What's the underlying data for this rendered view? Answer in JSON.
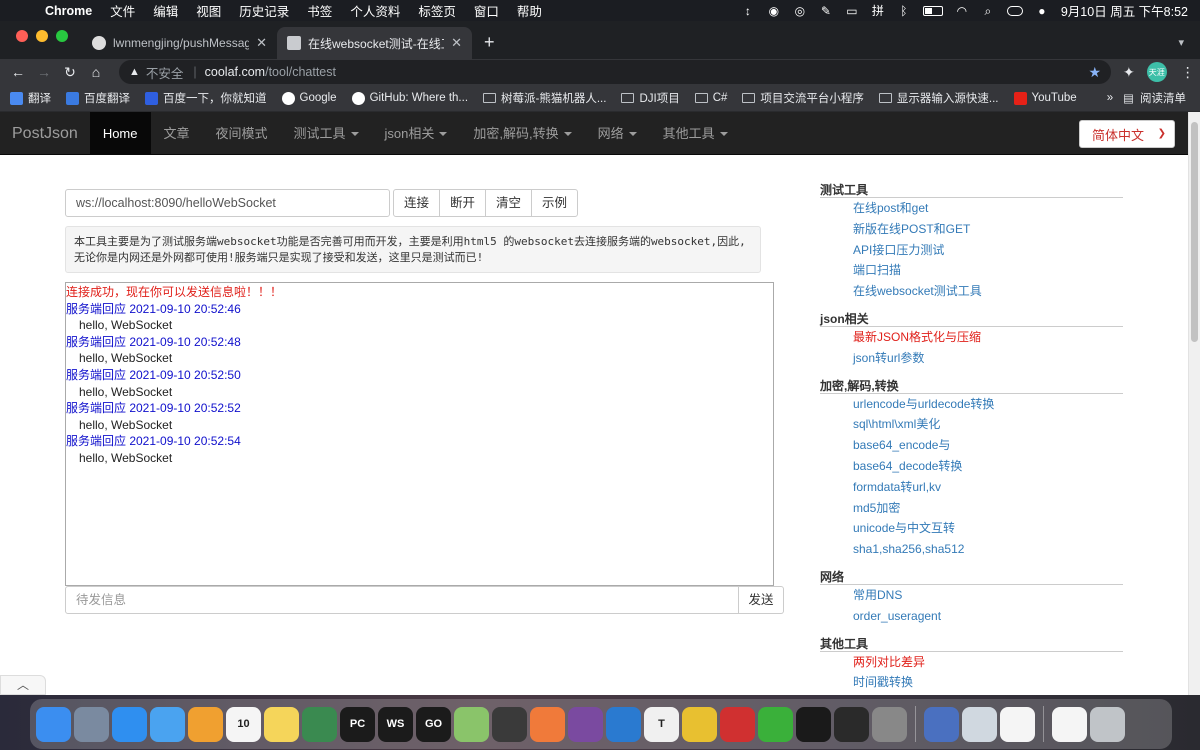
{
  "menubar": {
    "app": "Chrome",
    "items": [
      "文件",
      "编辑",
      "视图",
      "历史记录",
      "书签",
      "个人资料",
      "标签页",
      "窗口",
      "帮助"
    ],
    "clock": "9月10日 周五 下午8:52"
  },
  "tabs": [
    {
      "title": "lwnmengjing/pushMessage: Gi",
      "active": false
    },
    {
      "title": "在线websocket测试-在线工具-p",
      "active": true
    }
  ],
  "addressbar": {
    "security": "不安全",
    "host": "coolaf.com",
    "path": "/tool/chattest",
    "profile": "天涯"
  },
  "bookmarks": [
    "翻译",
    "百度翻译",
    "百度一下，你就知道",
    "Google",
    "GitHub: Where th...",
    "树莓派-熊猫机器人...",
    "DJI项目",
    "C#",
    "项目交流平台小程序",
    "显示器输入源快速...",
    "YouTube"
  ],
  "bookmarks_more": "»",
  "reading_list": "阅读清单",
  "site_nav": {
    "brand": "PostJson",
    "links": [
      {
        "label": "Home",
        "active": true,
        "dropdown": false
      },
      {
        "label": "文章",
        "active": false,
        "dropdown": false
      },
      {
        "label": "夜间模式",
        "active": false,
        "dropdown": false
      },
      {
        "label": "测试工具",
        "active": false,
        "dropdown": true
      },
      {
        "label": "json相关",
        "active": false,
        "dropdown": true
      },
      {
        "label": "加密,解码,转换",
        "active": false,
        "dropdown": true
      },
      {
        "label": "网络",
        "active": false,
        "dropdown": true
      },
      {
        "label": "其他工具",
        "active": false,
        "dropdown": true
      }
    ],
    "language": "简体中文"
  },
  "tool": {
    "ws_url": "ws://localhost:8090/helloWebSocket",
    "buttons": [
      "连接",
      "断开",
      "清空",
      "示例"
    ],
    "description": "本工具主要是为了测试服务端websocket功能是否完善可用而开发，主要是利用html5 的websocket去连接服务端的websocket,因此,无论你是内网还是外网都可使用!服务端只是实现了接受和发送，这里只是测试而已!",
    "connected_msg": "连接成功，现在你可以发送信息啦！！！",
    "messages": [
      {
        "header": "服务端回应 2021-09-10 20:52:46",
        "body": "hello, WebSocket"
      },
      {
        "header": "服务端回应 2021-09-10 20:52:48",
        "body": "hello, WebSocket"
      },
      {
        "header": "服务端回应 2021-09-10 20:52:50",
        "body": "hello, WebSocket"
      },
      {
        "header": "服务端回应 2021-09-10 20:52:52",
        "body": "hello, WebSocket"
      },
      {
        "header": "服务端回应 2021-09-10 20:52:54",
        "body": "hello, WebSocket"
      }
    ],
    "send_placeholder": "待发信息",
    "send_label": "发送"
  },
  "sidebar": [
    {
      "title": "测试工具",
      "links": [
        {
          "label": "在线post和get",
          "highlight": false
        },
        {
          "label": "新版在线POST和GET",
          "highlight": false
        },
        {
          "label": "API接口压力测试",
          "highlight": false
        },
        {
          "label": "端口扫描",
          "highlight": false
        },
        {
          "label": "在线websocket测试工具",
          "highlight": false
        }
      ]
    },
    {
      "title": "json相关",
      "links": [
        {
          "label": "最新JSON格式化与压缩",
          "highlight": true
        },
        {
          "label": "json转url参数",
          "highlight": false
        }
      ]
    },
    {
      "title": "加密,解码,转换",
      "links": [
        {
          "label": "urlencode与urldecode转换",
          "highlight": false
        },
        {
          "label": "sql\\html\\xml美化",
          "highlight": false
        },
        {
          "label": "base64_encode与",
          "highlight": false
        },
        {
          "label": "base64_decode转换",
          "highlight": false
        },
        {
          "label": "formdata转url,kv",
          "highlight": false
        },
        {
          "label": "md5加密",
          "highlight": false
        },
        {
          "label": "unicode与中文互转",
          "highlight": false
        },
        {
          "label": "sha1,sha256,sha512",
          "highlight": false
        }
      ]
    },
    {
      "title": "网络",
      "links": [
        {
          "label": "常用DNS",
          "highlight": false
        },
        {
          "label": "order_useragent",
          "highlight": false
        }
      ]
    },
    {
      "title": "其他工具",
      "links": [
        {
          "label": "两列对比差异",
          "highlight": true
        },
        {
          "label": "时间戳转换",
          "highlight": false
        }
      ]
    }
  ],
  "colors": {
    "link": "#337ab7",
    "highlight": "#e0201a",
    "server_msg": "#1010cc",
    "navbar": "#222222"
  },
  "dock": [
    {
      "name": "finder-icon",
      "color": "#3b8ef0",
      "label": ""
    },
    {
      "name": "launchpad-icon",
      "color": "#7a8aa0",
      "label": ""
    },
    {
      "name": "safari-icon",
      "color": "#2f8ff0",
      "label": ""
    },
    {
      "name": "mail-icon",
      "color": "#4aa3f0",
      "label": ""
    },
    {
      "name": "photos-icon",
      "color": "#f0a030",
      "label": ""
    },
    {
      "name": "calendar-icon",
      "color": "#f5f5f5",
      "label": "10"
    },
    {
      "name": "notes-icon",
      "color": "#f5d55a",
      "label": ""
    },
    {
      "name": "arc-icon",
      "color": "#3a8a50",
      "label": ""
    },
    {
      "name": "pycharm-icon",
      "color": "#1b1b1b",
      "label": "PC"
    },
    {
      "name": "webstorm-icon",
      "color": "#1b1b1b",
      "label": "WS"
    },
    {
      "name": "goland-icon",
      "color": "#1b1b1b",
      "label": "GO"
    },
    {
      "name": "chat-icon",
      "color": "#8ac46a",
      "label": ""
    },
    {
      "name": "forklift-icon",
      "color": "#3a3a3a",
      "label": ""
    },
    {
      "name": "transmit-icon",
      "color": "#f07a3a",
      "label": ""
    },
    {
      "name": "github-desktop-icon",
      "color": "#7a4aa0",
      "label": ""
    },
    {
      "name": "vscode-icon",
      "color": "#2a7ad0",
      "label": ""
    },
    {
      "name": "typora-icon",
      "color": "#f0f0f0",
      "label": "T"
    },
    {
      "name": "chrome-icon",
      "color": "#e8c030",
      "label": ""
    },
    {
      "name": "netease-music-icon",
      "color": "#d03030",
      "label": ""
    },
    {
      "name": "wechat-icon",
      "color": "#3ab03a",
      "label": ""
    },
    {
      "name": "terminal-icon",
      "color": "#1a1a1a",
      "label": ""
    },
    {
      "name": "activity-monitor-icon",
      "color": "#2a2a2a",
      "label": ""
    },
    {
      "name": "system-preferences-icon",
      "color": "#888888",
      "label": ""
    },
    {
      "name": "sep",
      "color": "",
      "label": ""
    },
    {
      "name": "link-app-icon",
      "color": "#4a70c0",
      "label": ""
    },
    {
      "name": "preview-icon",
      "color": "#d0d8e0",
      "label": ""
    },
    {
      "name": "numbers-icon",
      "color": "#f5f5f5",
      "label": ""
    },
    {
      "name": "sep",
      "color": "",
      "label": ""
    },
    {
      "name": "document-icon",
      "color": "#f5f5f5",
      "label": ""
    },
    {
      "name": "trash-icon",
      "color": "#c0c4c8",
      "label": ""
    }
  ]
}
